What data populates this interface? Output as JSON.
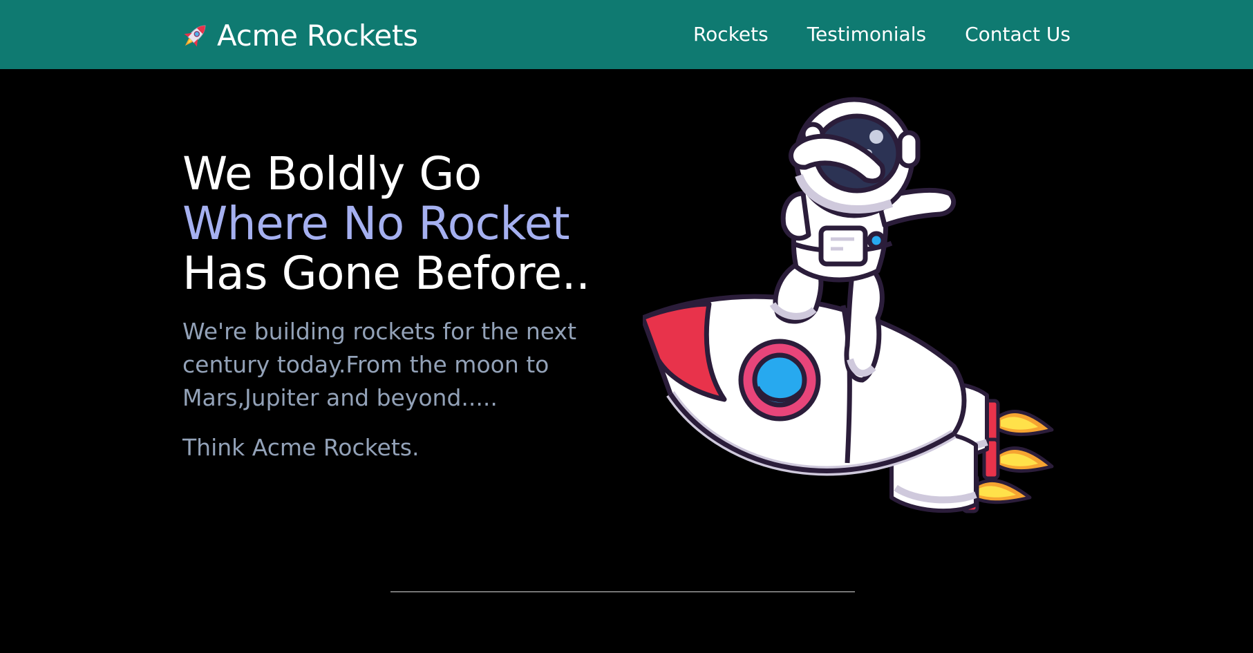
{
  "header": {
    "brand_name": "Acme Rockets",
    "brand_icon": "rocket-icon",
    "background_color": "#0f7a71",
    "nav": [
      {
        "label": "Rockets"
      },
      {
        "label": "Testimonials"
      },
      {
        "label": "Contact Us"
      }
    ]
  },
  "hero": {
    "title_line_1": "We Boldly Go",
    "title_line_2": "Where No Rocket",
    "title_line_3": "Has Gone Before..",
    "accent_color": "#a5b0f0",
    "description": "We're building rockets for the next century today.From the moon to Mars,Jupiter and beyond.....",
    "tagline": "Think Acme Rockets.",
    "illustration": "astronaut-on-rocket-illustration"
  }
}
